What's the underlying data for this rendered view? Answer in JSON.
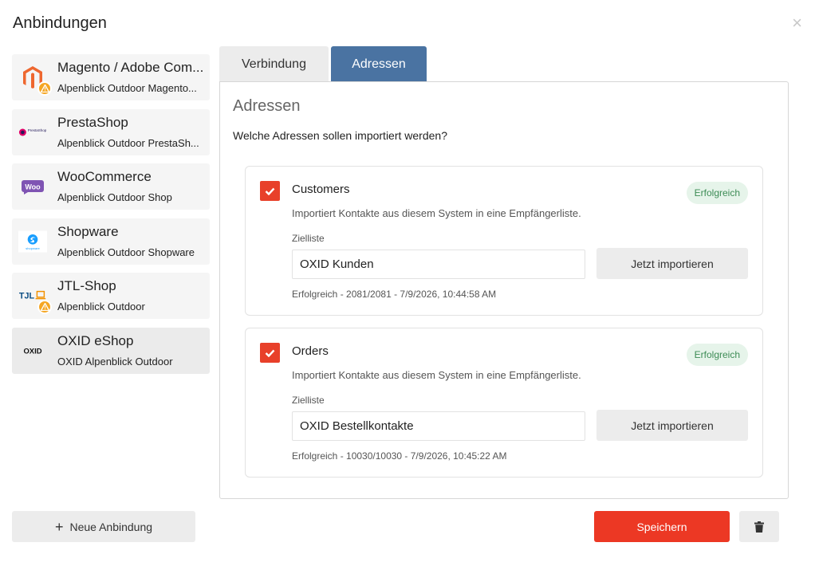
{
  "dialog": {
    "title": "Anbindungen",
    "close_symbol": "×"
  },
  "sidebar": {
    "items": [
      {
        "name": "Magento / Adobe Com...",
        "subtitle": "Alpenblick Outdoor Magento...",
        "logo": "magento-logo",
        "warning": true
      },
      {
        "name": "PrestaShop",
        "subtitle": "Alpenblick Outdoor PrestaSh...",
        "logo": "prestashop-logo",
        "logo_text": "PrestaShop",
        "warning": false
      },
      {
        "name": "WooCommerce",
        "subtitle": "Alpenblick Outdoor Shop",
        "logo": "woocommerce-logo",
        "logo_text": "Woo",
        "warning": false
      },
      {
        "name": "Shopware",
        "subtitle": "Alpenblick Outdoor Shopware",
        "logo": "shopware-logo",
        "logo_text": "shopware",
        "warning": false
      },
      {
        "name": "JTL-Shop",
        "subtitle": "Alpenblick Outdoor",
        "logo": "jtl-logo",
        "logo_text": "TJL",
        "warning": true
      },
      {
        "name": "OXID eShop",
        "subtitle": "OXID Alpenblick Outdoor",
        "logo": "oxid-logo",
        "logo_text": "OXID",
        "warning": false,
        "active": true
      }
    ]
  },
  "tabs": [
    {
      "label": "Verbindung",
      "active": false
    },
    {
      "label": "Adressen",
      "active": true
    }
  ],
  "panel": {
    "title": "Adressen",
    "question": "Welche Adressen sollen importiert werden?",
    "cards": [
      {
        "title": "Customers",
        "checked": true,
        "badge": "Erfolgreich",
        "description": "Importiert Kontakte aus diesem System in eine Empfängerliste.",
        "target_label": "Zielliste",
        "target_value": "OXID Kunden",
        "import_button": "Jetzt importieren",
        "status": "Erfolgreich - 2081/2081 - 7/9/2026, 10:44:58 AM"
      },
      {
        "title": "Orders",
        "checked": true,
        "badge": "Erfolgreich",
        "description": "Importiert Kontakte aus diesem System in eine Empfängerliste.",
        "target_label": "Zielliste",
        "target_value": "OXID Bestellkontakte",
        "import_button": "Jetzt importieren",
        "status": "Erfolgreich - 10030/10030 - 7/9/2026, 10:45:22 AM"
      }
    ]
  },
  "footer": {
    "new_connection": "Neue Anbindung",
    "plus": "+",
    "save": "Speichern"
  },
  "colors": {
    "accent_tab": "#4a73a2",
    "primary": "#ec3824",
    "checkbox": "#e8402a",
    "success_bg": "#e6f4ea",
    "success_text": "#3d8c55",
    "warning": "#f5a623"
  }
}
